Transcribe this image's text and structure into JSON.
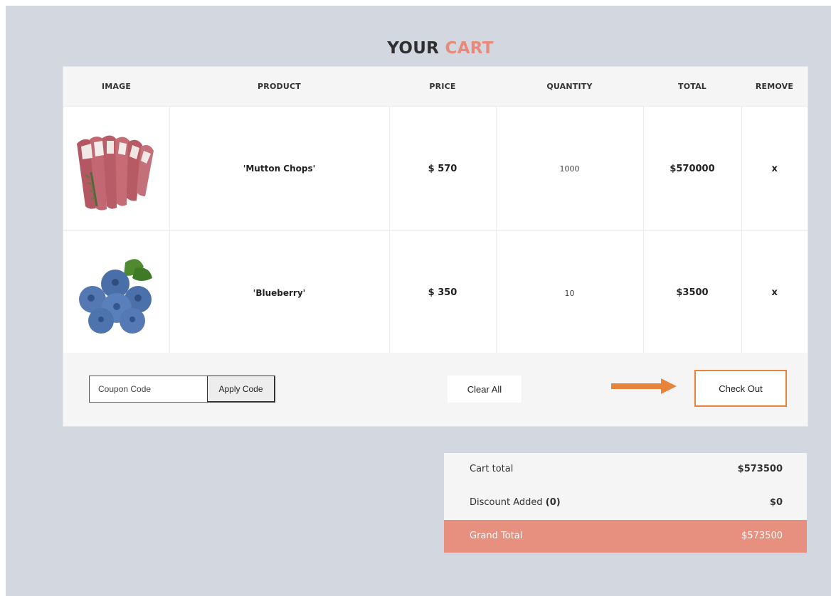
{
  "title": {
    "part1": "YOUR",
    "part2": "CART"
  },
  "table": {
    "headers": [
      "IMAGE",
      "PRODUCT",
      "PRICE",
      "QUANTITY",
      "TOTAL",
      "REMOVE"
    ],
    "rows": [
      {
        "image_icon": "mutton-chops-image",
        "product": "'Mutton Chops'",
        "price": "$ 570",
        "quantity": "1000",
        "total": "$570000",
        "remove": "x"
      },
      {
        "image_icon": "blueberry-image",
        "product": "'Blueberry'",
        "price": "$ 350",
        "quantity": "10",
        "total": "$3500",
        "remove": "x"
      }
    ]
  },
  "actions": {
    "coupon_placeholder": "Coupon Code",
    "apply_label": "Apply Code",
    "clear_label": "Clear All",
    "checkout_label": "Check Out",
    "arrow_icon": "arrow-right-icon"
  },
  "summary": {
    "cart_total_label": "Cart total",
    "cart_total_value": "$573500",
    "discount_label": "Discount Added",
    "discount_count": "(0)",
    "discount_value": "$0",
    "grand_total_label": "Grand Total",
    "grand_total_value": "$573500"
  },
  "colors": {
    "accent": "#e8897a",
    "grand_total_bg": "#e8907f",
    "arrow": "#e8833a",
    "page_bg": "#d3d8e0"
  }
}
